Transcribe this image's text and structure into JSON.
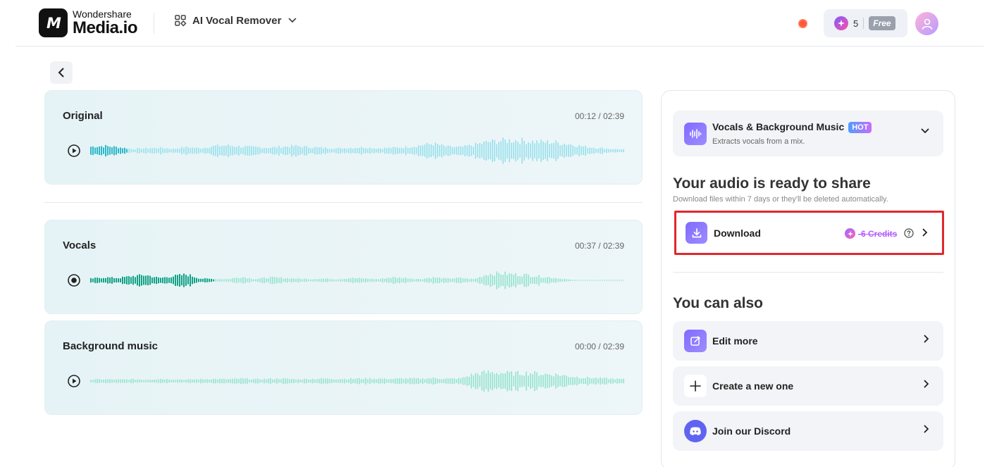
{
  "header": {
    "logo_top": "Wondershare",
    "logo_bottom": "Media.io",
    "tool_name": "AI Vocal Remover",
    "credits_count": "5",
    "plan_badge": "Free"
  },
  "tracks": [
    {
      "title": "Original",
      "time": "00:12 / 02:39",
      "progress": 0.07,
      "accent": "#2bb7c9",
      "light": "#a6e4ee"
    },
    {
      "title": "Vocals",
      "time": "00:37 / 02:39",
      "progress": 0.23,
      "accent": "#11a184",
      "light": "#a4e6d6"
    },
    {
      "title": "Background music",
      "time": "00:00 / 02:39",
      "progress": 0.0,
      "accent": "#11a184",
      "light": "#a4e6d6"
    }
  ],
  "panel": {
    "mode_title": "Vocals & Background Music",
    "mode_badge": "HOT",
    "mode_sub": "Extracts vocals from a mix.",
    "ready_title": "Your audio is ready to share",
    "ready_sub": "Download files within 7 days or they'll be deleted automatically.",
    "download_label": "Download",
    "download_credits": "-6 Credits",
    "also_title": "You can also",
    "actions": [
      {
        "label": "Edit more"
      },
      {
        "label": "Create a new one"
      },
      {
        "label": "Join our Discord"
      }
    ]
  },
  "colors": {
    "accent_purple": "#7e6bff",
    "highlight_red": "#e0282d"
  }
}
